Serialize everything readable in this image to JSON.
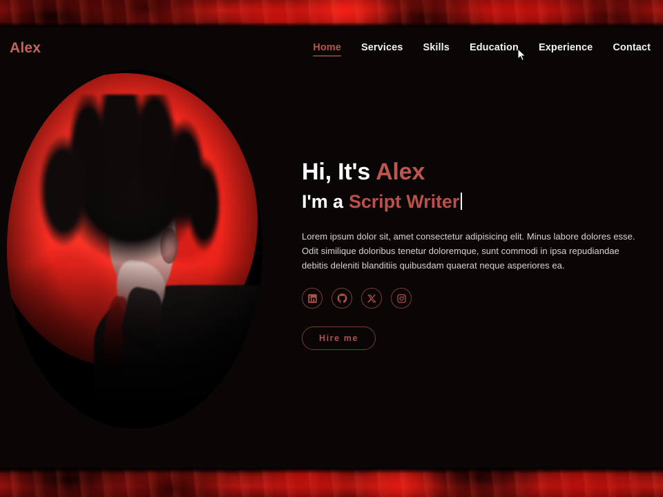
{
  "site": {
    "logo": "Alex",
    "nav": [
      {
        "label": "Home",
        "active": true
      },
      {
        "label": "Services",
        "active": false
      },
      {
        "label": "Skills",
        "active": false
      },
      {
        "label": "Education",
        "active": false
      },
      {
        "label": "Experience",
        "active": false
      },
      {
        "label": "Contact",
        "active": false
      }
    ]
  },
  "hero": {
    "greeting_prefix": "Hi, It's",
    "name": "Alex",
    "role_prefix": "I'm a",
    "role": "Script Writer",
    "typing_caret": "|",
    "description": "Lorem ipsum dolor sit, amet consectetur adipisicing elit. Minus labore dolores esse. Odit similique doloribus tenetur doloremque, sunt commodi in ipsa repudiandae debitis deleniti blanditiis quibusdam quaerat neque asperiores ea.",
    "cta_label": "Hire me",
    "socials": [
      {
        "name": "linkedin-icon",
        "label": "LinkedIn"
      },
      {
        "name": "github-icon",
        "label": "GitHub"
      },
      {
        "name": "x-twitter-icon",
        "label": "X"
      },
      {
        "name": "instagram-icon",
        "label": "Instagram"
      }
    ]
  },
  "portrait": {
    "alt": "Anime illustration of a dark-haired man in profile against a red blood moon"
  },
  "colors": {
    "background": "#0a0606",
    "accent_red": "#bd5550",
    "accent_dim": "#7c3c39",
    "banner_red": "#b81510",
    "moon_red": "#f5291f",
    "text_primary": "#ffffff",
    "text_muted": "#d8d4d2"
  }
}
